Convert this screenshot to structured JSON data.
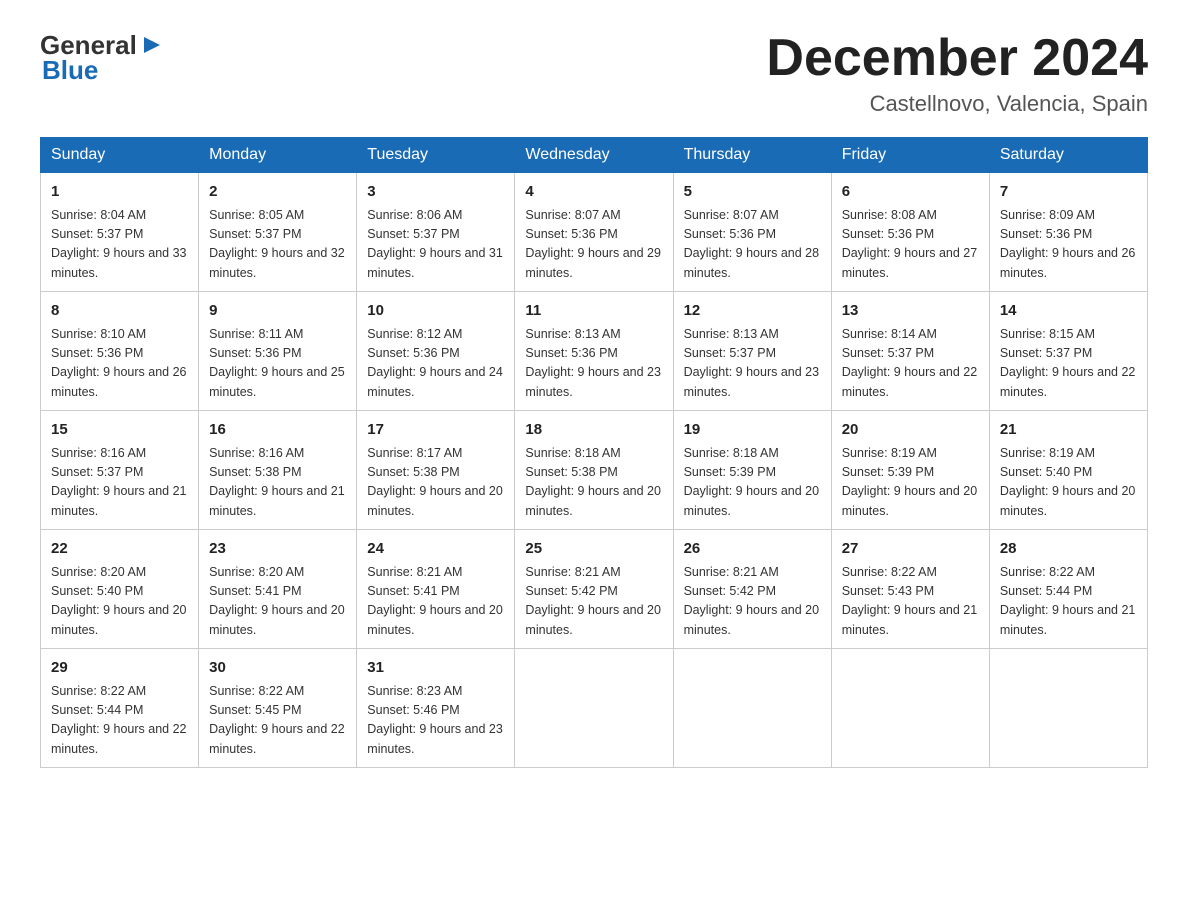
{
  "logo": {
    "general": "General",
    "blue": "Blue",
    "arrow": "▶"
  },
  "title": "December 2024",
  "subtitle": "Castellnovo, Valencia, Spain",
  "days_of_week": [
    "Sunday",
    "Monday",
    "Tuesday",
    "Wednesday",
    "Thursday",
    "Friday",
    "Saturday"
  ],
  "weeks": [
    [
      {
        "day": "1",
        "sunrise": "8:04 AM",
        "sunset": "5:37 PM",
        "daylight": "9 hours and 33 minutes."
      },
      {
        "day": "2",
        "sunrise": "8:05 AM",
        "sunset": "5:37 PM",
        "daylight": "9 hours and 32 minutes."
      },
      {
        "day": "3",
        "sunrise": "8:06 AM",
        "sunset": "5:37 PM",
        "daylight": "9 hours and 31 minutes."
      },
      {
        "day": "4",
        "sunrise": "8:07 AM",
        "sunset": "5:36 PM",
        "daylight": "9 hours and 29 minutes."
      },
      {
        "day": "5",
        "sunrise": "8:07 AM",
        "sunset": "5:36 PM",
        "daylight": "9 hours and 28 minutes."
      },
      {
        "day": "6",
        "sunrise": "8:08 AM",
        "sunset": "5:36 PM",
        "daylight": "9 hours and 27 minutes."
      },
      {
        "day": "7",
        "sunrise": "8:09 AM",
        "sunset": "5:36 PM",
        "daylight": "9 hours and 26 minutes."
      }
    ],
    [
      {
        "day": "8",
        "sunrise": "8:10 AM",
        "sunset": "5:36 PM",
        "daylight": "9 hours and 26 minutes."
      },
      {
        "day": "9",
        "sunrise": "8:11 AM",
        "sunset": "5:36 PM",
        "daylight": "9 hours and 25 minutes."
      },
      {
        "day": "10",
        "sunrise": "8:12 AM",
        "sunset": "5:36 PM",
        "daylight": "9 hours and 24 minutes."
      },
      {
        "day": "11",
        "sunrise": "8:13 AM",
        "sunset": "5:36 PM",
        "daylight": "9 hours and 23 minutes."
      },
      {
        "day": "12",
        "sunrise": "8:13 AM",
        "sunset": "5:37 PM",
        "daylight": "9 hours and 23 minutes."
      },
      {
        "day": "13",
        "sunrise": "8:14 AM",
        "sunset": "5:37 PM",
        "daylight": "9 hours and 22 minutes."
      },
      {
        "day": "14",
        "sunrise": "8:15 AM",
        "sunset": "5:37 PM",
        "daylight": "9 hours and 22 minutes."
      }
    ],
    [
      {
        "day": "15",
        "sunrise": "8:16 AM",
        "sunset": "5:37 PM",
        "daylight": "9 hours and 21 minutes."
      },
      {
        "day": "16",
        "sunrise": "8:16 AM",
        "sunset": "5:38 PM",
        "daylight": "9 hours and 21 minutes."
      },
      {
        "day": "17",
        "sunrise": "8:17 AM",
        "sunset": "5:38 PM",
        "daylight": "9 hours and 20 minutes."
      },
      {
        "day": "18",
        "sunrise": "8:18 AM",
        "sunset": "5:38 PM",
        "daylight": "9 hours and 20 minutes."
      },
      {
        "day": "19",
        "sunrise": "8:18 AM",
        "sunset": "5:39 PM",
        "daylight": "9 hours and 20 minutes."
      },
      {
        "day": "20",
        "sunrise": "8:19 AM",
        "sunset": "5:39 PM",
        "daylight": "9 hours and 20 minutes."
      },
      {
        "day": "21",
        "sunrise": "8:19 AM",
        "sunset": "5:40 PM",
        "daylight": "9 hours and 20 minutes."
      }
    ],
    [
      {
        "day": "22",
        "sunrise": "8:20 AM",
        "sunset": "5:40 PM",
        "daylight": "9 hours and 20 minutes."
      },
      {
        "day": "23",
        "sunrise": "8:20 AM",
        "sunset": "5:41 PM",
        "daylight": "9 hours and 20 minutes."
      },
      {
        "day": "24",
        "sunrise": "8:21 AM",
        "sunset": "5:41 PM",
        "daylight": "9 hours and 20 minutes."
      },
      {
        "day": "25",
        "sunrise": "8:21 AM",
        "sunset": "5:42 PM",
        "daylight": "9 hours and 20 minutes."
      },
      {
        "day": "26",
        "sunrise": "8:21 AM",
        "sunset": "5:42 PM",
        "daylight": "9 hours and 20 minutes."
      },
      {
        "day": "27",
        "sunrise": "8:22 AM",
        "sunset": "5:43 PM",
        "daylight": "9 hours and 21 minutes."
      },
      {
        "day": "28",
        "sunrise": "8:22 AM",
        "sunset": "5:44 PM",
        "daylight": "9 hours and 21 minutes."
      }
    ],
    [
      {
        "day": "29",
        "sunrise": "8:22 AM",
        "sunset": "5:44 PM",
        "daylight": "9 hours and 22 minutes."
      },
      {
        "day": "30",
        "sunrise": "8:22 AM",
        "sunset": "5:45 PM",
        "daylight": "9 hours and 22 minutes."
      },
      {
        "day": "31",
        "sunrise": "8:23 AM",
        "sunset": "5:46 PM",
        "daylight": "9 hours and 23 minutes."
      },
      null,
      null,
      null,
      null
    ]
  ]
}
